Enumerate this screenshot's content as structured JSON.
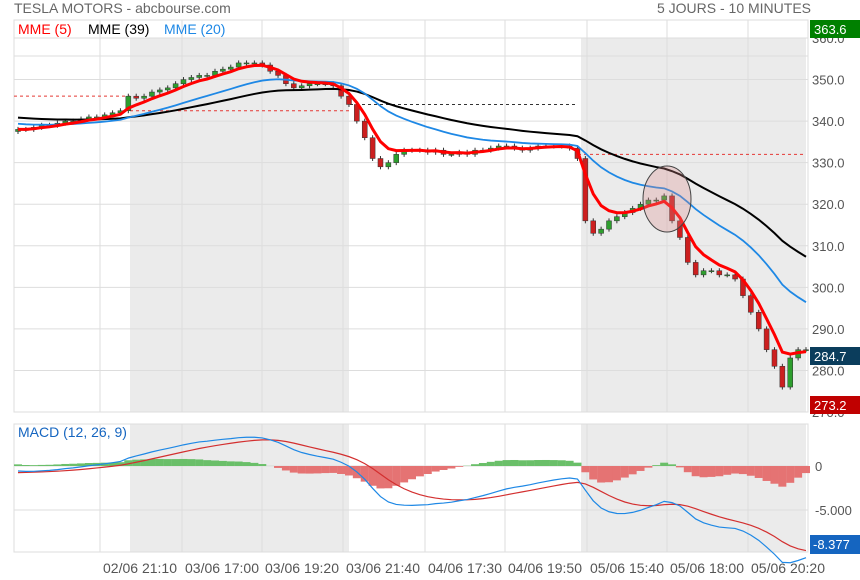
{
  "header": {
    "title": "TESLA MOTORS - abcbourse.com",
    "period": "5 JOURS - 10 MINUTES"
  },
  "legend": [
    {
      "label": "MME (5)",
      "color": "#ff0000"
    },
    {
      "label": "MME (39)",
      "color": "#000000"
    },
    {
      "label": "MME (20)",
      "color": "#1e88e5"
    }
  ],
  "macd_label": "MACD (12, 26, 9)",
  "chart_data": {
    "type": "line",
    "title": "TESLA MOTORS",
    "price_ylim": [
      270,
      360
    ],
    "price_ticks": [
      "360.0",
      "350.0",
      "340.0",
      "330.0",
      "320.0",
      "310.0",
      "300.0",
      "290.0",
      "280.0",
      "270.0"
    ],
    "price_tick_values": [
      360,
      350,
      340,
      330,
      320,
      310,
      300,
      290,
      280,
      270
    ],
    "x_labels": [
      "02/06 21:10",
      "03/06 17:00",
      "03/06 19:20",
      "03/06 21:40",
      "04/06 17:30",
      "04/06 19:50",
      "05/06 15:40",
      "05/06 18:00",
      "05/06 20:20"
    ],
    "close": [
      338,
      338,
      338.5,
      339,
      339,
      339.5,
      340,
      340,
      340.5,
      341,
      341,
      341.5,
      342,
      342.5,
      346,
      345.5,
      346,
      347,
      347.5,
      348,
      349,
      350,
      350.5,
      351,
      351,
      352,
      352.5,
      353,
      354,
      354,
      354,
      353.5,
      352,
      351,
      349,
      348,
      348.5,
      349,
      349,
      349,
      348.5,
      346,
      344,
      340,
      336,
      331,
      329,
      330,
      332,
      333,
      333,
      333,
      332.5,
      333,
      332,
      332,
      332.5,
      332,
      333,
      333,
      333.5,
      334,
      334,
      333.5,
      333,
      333.5,
      334,
      334,
      334,
      334,
      333.5,
      331,
      316,
      313,
      314,
      316,
      317,
      318,
      319,
      320,
      321,
      321,
      322,
      316,
      312,
      306,
      303,
      304,
      304,
      303,
      303,
      302,
      298,
      294,
      290,
      285,
      281,
      276,
      283,
      285,
      285
    ],
    "ema_periods": [
      5,
      39,
      20
    ],
    "ema_colors": [
      "#ff0000",
      "#000000",
      "#1e88e5"
    ],
    "ref_lines": [
      {
        "value": 346,
        "color": "#e53935"
      },
      {
        "value": 342.5,
        "color": "#e53935"
      },
      {
        "value": 344,
        "color": "#333333"
      },
      {
        "value": 332,
        "color": "#e53935"
      }
    ],
    "price_tags": [
      {
        "label": "363.6",
        "color": "#008000"
      },
      {
        "label": "284.7",
        "color": "#0b3d5c"
      },
      {
        "label": "273.2",
        "color": "#c00000"
      }
    ],
    "macd": {
      "params": [
        12,
        26,
        9
      ],
      "ylim": [
        -9.8,
        4
      ],
      "ticks": [
        "0",
        "-5.000"
      ],
      "tick_values": [
        0,
        -5
      ],
      "last_label": "-8.377",
      "macd_color": "#1e88e5",
      "signal_color": "#d32f2f",
      "hist_pos": "#6abf69",
      "hist_neg": "#e57373"
    }
  }
}
